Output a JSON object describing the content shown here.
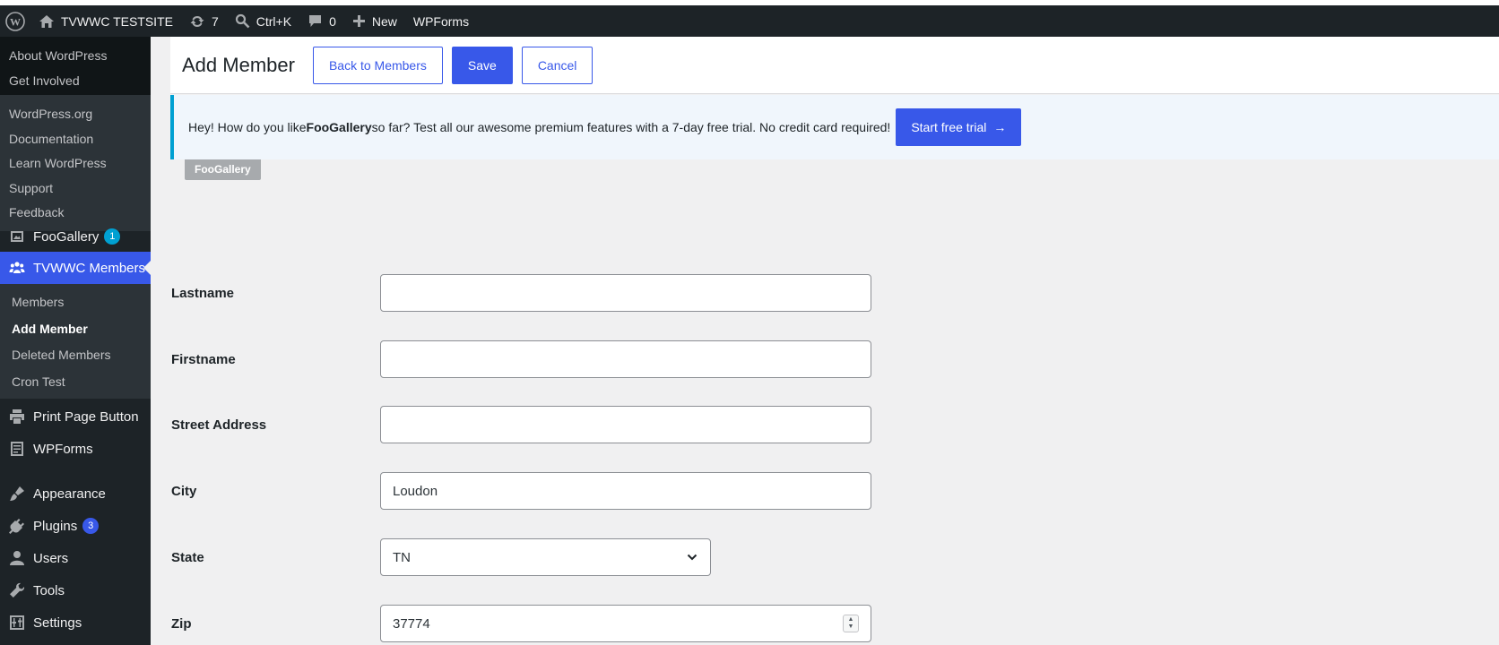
{
  "admin_bar": {
    "site_name": "TVWWC TESTSITE",
    "updates_count": "7",
    "search_shortcut": "Ctrl+K",
    "comments_count": "0",
    "new_label": "New",
    "wpforms_label": "WPForms"
  },
  "wp_flyout": {
    "items": [
      "About WordPress",
      "Get Involved"
    ],
    "links": [
      "WordPress.org",
      "Documentation",
      "Learn WordPress",
      "Support",
      "Feedback"
    ]
  },
  "sidebar": {
    "foogallery": {
      "label": "FooGallery",
      "badge": "1"
    },
    "members": {
      "label": "TVWWC Members"
    },
    "submenu": [
      "Members",
      "Add Member",
      "Deleted Members",
      "Cron Test"
    ],
    "print_page": {
      "label": "Print Page Button"
    },
    "wpforms": {
      "label": "WPForms"
    },
    "appearance": {
      "label": "Appearance"
    },
    "plugins": {
      "label": "Plugins",
      "badge": "3"
    },
    "users": {
      "label": "Users"
    },
    "tools": {
      "label": "Tools"
    },
    "settings": {
      "label": "Settings"
    }
  },
  "header": {
    "title": "Add Member",
    "back_label": "Back to Members",
    "save_label": "Save",
    "cancel_label": "Cancel"
  },
  "notice": {
    "text_before": "Hey! How do you like ",
    "brand": "FooGallery",
    "text_after": " so far? Test all our awesome premium features with a 7-day free trial. No credit card required!",
    "cta_label": "Start free trial",
    "cta_arrow": "→",
    "tag": "FooGallery"
  },
  "form": {
    "lastname": {
      "label": "Lastname",
      "value": ""
    },
    "firstname": {
      "label": "Firstname",
      "value": ""
    },
    "street": {
      "label": "Street Address",
      "value": ""
    },
    "city": {
      "label": "City",
      "value": "Loudon"
    },
    "state": {
      "label": "State",
      "value": "TN"
    },
    "zip": {
      "label": "Zip",
      "value": "37774"
    }
  },
  "colors": {
    "accent": "#3858e9",
    "admin_bar": "#1d2327",
    "notice_border": "#00a0d2"
  }
}
